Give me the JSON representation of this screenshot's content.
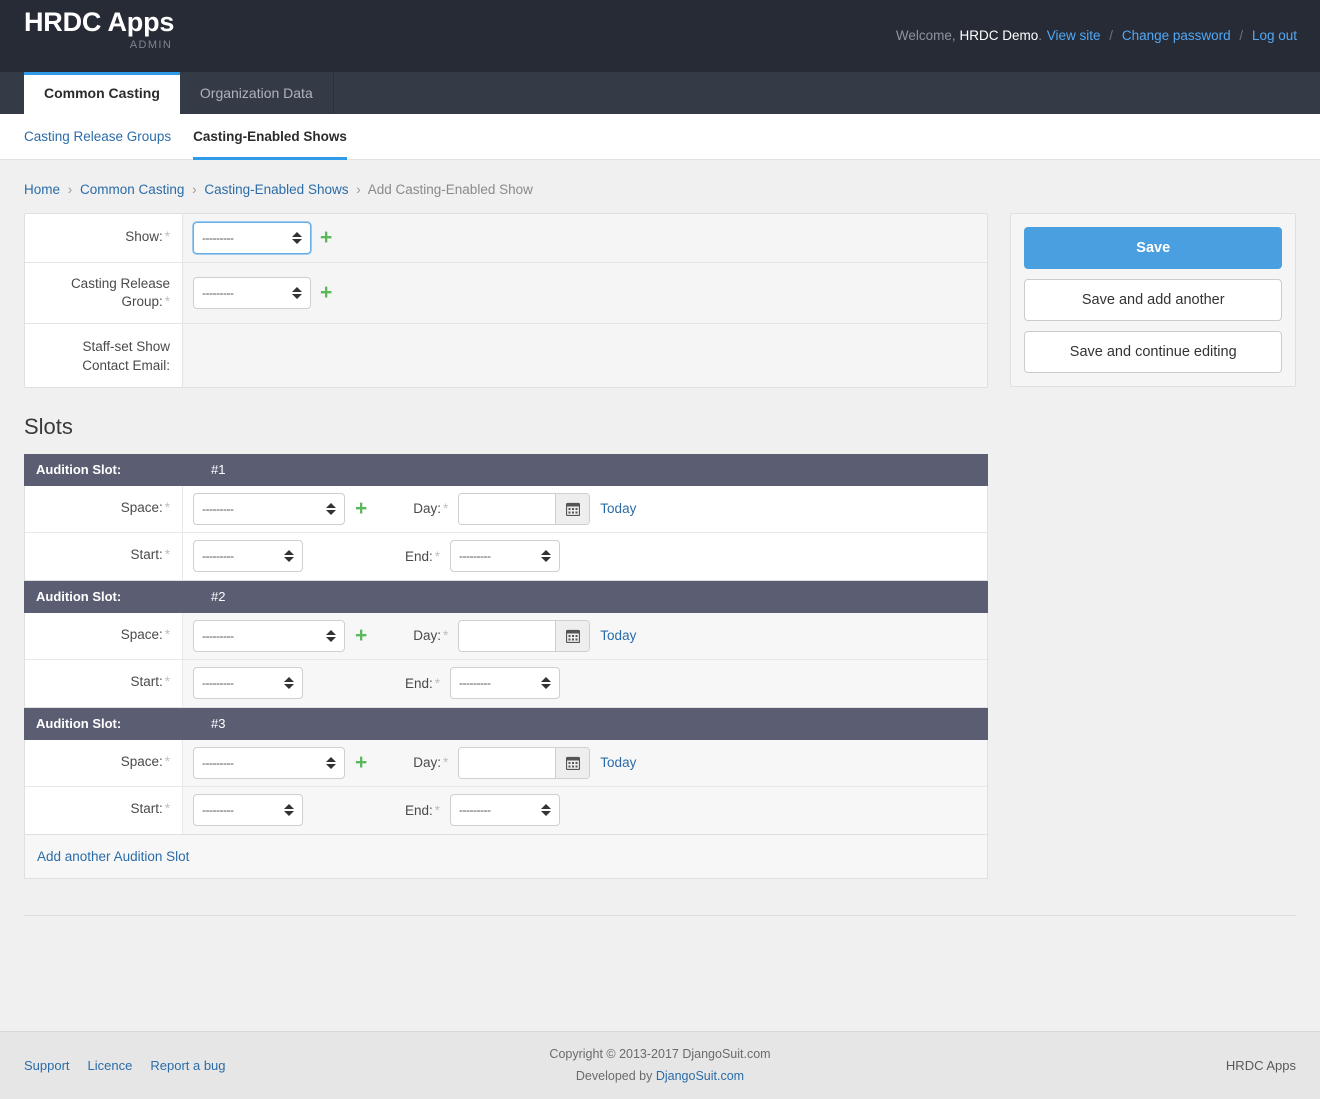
{
  "header": {
    "brand_title": "HRDC Apps",
    "brand_subtitle": "ADMIN",
    "welcome_prefix": "Welcome,",
    "username": "HRDC Demo",
    "welcome_suffix": ".",
    "view_site": "View site",
    "change_password": "Change password",
    "log_out": "Log out",
    "separator": "/"
  },
  "tabs": [
    {
      "label": "Common Casting",
      "active": true
    },
    {
      "label": "Organization Data",
      "active": false
    }
  ],
  "subnav": [
    {
      "label": "Casting Release Groups",
      "active": false
    },
    {
      "label": "Casting-Enabled Shows",
      "active": true
    }
  ],
  "breadcrumb": {
    "sep": "›",
    "items": [
      {
        "label": "Home",
        "link": true
      },
      {
        "label": "Common Casting",
        "link": true
      },
      {
        "label": "Casting-Enabled Shows",
        "link": true
      },
      {
        "label": "Add Casting-Enabled Show",
        "link": false
      }
    ]
  },
  "form": {
    "select_placeholder": "---------",
    "required_marker": "*",
    "add_icon": "+",
    "fields": [
      {
        "label": "Show:",
        "required": true,
        "widget": "select",
        "value": "---------",
        "has_add": true,
        "focused": true
      },
      {
        "label": "Casting Release Group:",
        "required": true,
        "widget": "select",
        "value": "---------",
        "has_add": true,
        "focused": false
      },
      {
        "label": "Staff-set Show Contact Email:",
        "required": false,
        "widget": "none",
        "value": "",
        "has_add": false,
        "focused": false
      }
    ]
  },
  "save_panel": {
    "save": "Save",
    "save_and_add_another": "Save and add another",
    "save_and_continue": "Save and continue editing"
  },
  "slots": {
    "title": "Slots",
    "head_label": "Audition Slot:",
    "add_another": "Add another Audition Slot",
    "labels": {
      "space": "Space:",
      "day": "Day:",
      "start": "Start:",
      "end": "End:"
    },
    "today_link": "Today",
    "calendar_icon": "calendar-icon",
    "date_value": "",
    "date_placeholder": "",
    "items": [
      {
        "number": "#1",
        "space": "---------",
        "day": "",
        "start": "---------",
        "end": "---------"
      },
      {
        "number": "#2",
        "space": "---------",
        "day": "",
        "start": "---------",
        "end": "---------"
      },
      {
        "number": "#3",
        "space": "---------",
        "day": "",
        "start": "---------",
        "end": "---------"
      }
    ]
  },
  "footer": {
    "links": [
      {
        "label": "Support"
      },
      {
        "label": "Licence"
      },
      {
        "label": "Report a bug"
      }
    ],
    "copyright": "Copyright © 2013-2017 DjangoSuit.com",
    "developed_prefix": "Developed by ",
    "developed_link": "DjangoSuit.com",
    "right_label": "HRDC Apps"
  },
  "colors": {
    "header_bg": "#272b35",
    "tabbar_bg": "#343a46",
    "accent_blue": "#2f9be8",
    "link_blue": "#2b6ca8",
    "primary_button": "#4a9fe0",
    "slot_header": "#5b5e73",
    "add_green": "#5cb85c"
  }
}
